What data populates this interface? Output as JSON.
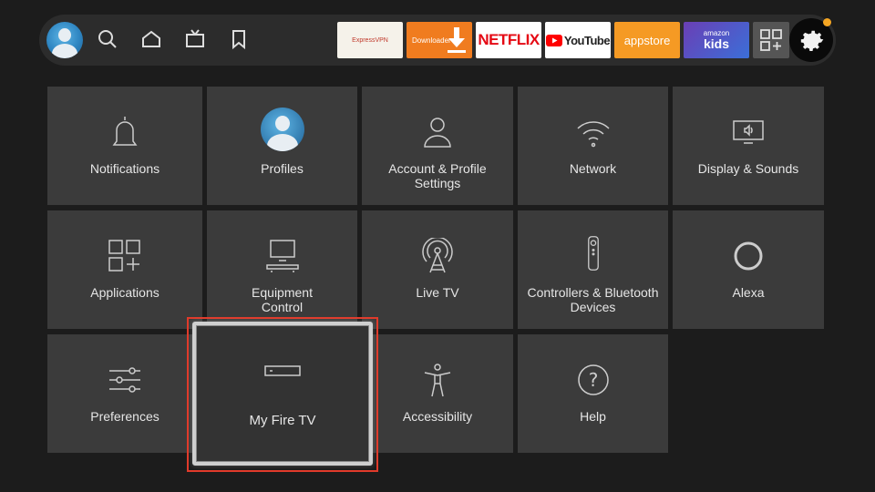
{
  "topbar": {
    "nav_icons": [
      "profile-avatar",
      "search-icon",
      "home-icon",
      "live-tv-icon",
      "watchlist-icon"
    ],
    "apps": {
      "expressvpn": "ExpressVPN",
      "downloader": "Downloader",
      "netflix": "NETFLIX",
      "youtube": "YouTube",
      "appstore": "appstore",
      "kids_top": "amazon",
      "kids_bottom": "kids"
    },
    "accent": "#f5a623"
  },
  "settings_tiles": [
    {
      "label": "Notifications",
      "icon": "bell-icon"
    },
    {
      "label": "Profiles",
      "icon": "profile-icon"
    },
    {
      "label": "Account & Profile Settings",
      "icon": "user-icon"
    },
    {
      "label": "Network",
      "icon": "wifi-icon"
    },
    {
      "label": "Display & Sounds",
      "icon": "display-icon"
    },
    {
      "label": "Applications",
      "icon": "apps-icon"
    },
    {
      "label": "Equipment Control",
      "icon": "equipment-icon"
    },
    {
      "label": "Live TV",
      "icon": "antenna-icon"
    },
    {
      "label": "Controllers & Bluetooth Devices",
      "icon": "remote-icon"
    },
    {
      "label": "Alexa",
      "icon": "alexa-icon"
    },
    {
      "label": "Preferences",
      "icon": "sliders-icon"
    },
    {
      "label": "My Fire TV",
      "icon": "fire-tv-device-icon",
      "focused": true
    },
    {
      "label": "Accessibility",
      "icon": "accessibility-icon"
    },
    {
      "label": "Help",
      "icon": "help-icon"
    }
  ],
  "focus_color": "#e03a2a"
}
